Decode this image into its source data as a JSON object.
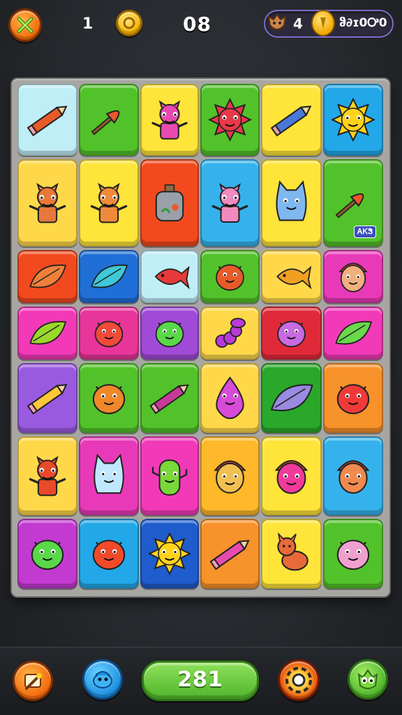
{
  "colors": {
    "board": "#a7a6a3",
    "accent_green": "#4fb52b",
    "accent_orange": "#f26a0c"
  },
  "topbar": {
    "close_icon": "crossed-swords-icon",
    "lives": "1",
    "coin_icon": "coin-icon",
    "level": "08",
    "mascot_icon": "fox-mascot-icon",
    "gems": "4",
    "gold_icon": "gold-coin-icon",
    "gold": "ჵ∂ɪ0Ꭴ0"
  },
  "board": {
    "rows": [
      [
        {
          "bg": "#bfeef7",
          "icon": "pencil-icon",
          "art": "pencil",
          "c": "#e85a2a"
        },
        {
          "bg": "#52c22a",
          "icon": "brush-icon",
          "art": "brush",
          "c": "#e8582a"
        },
        {
          "bg": "#ffe43a",
          "icon": "girl-doll-icon",
          "art": "figure",
          "c": "#e84ab0"
        },
        {
          "bg": "#52c22a",
          "icon": "red-sun-icon",
          "art": "sun",
          "c": "#e8394a"
        },
        {
          "bg": "#ffe43a",
          "icon": "pencil-icon",
          "art": "pencil",
          "c": "#4a78d8"
        },
        {
          "bg": "#22a8e8",
          "icon": "sun-icon",
          "art": "sun",
          "c": "#ffd31a"
        }
      ],
      [
        {
          "bg": "#ffd84a",
          "icon": "fox-figure-icon",
          "art": "figure",
          "c": "#e8783a"
        },
        {
          "bg": "#ffe43a",
          "icon": "bear-figure-icon",
          "art": "figure",
          "c": "#ef8a3a"
        },
        {
          "bg": "#f24a1e",
          "icon": "potion-bottle-icon",
          "art": "bottle",
          "c": "#9aa0a8"
        },
        {
          "bg": "#35b2ec",
          "icon": "girl-figure-icon",
          "art": "figure",
          "c": "#f08abf"
        },
        {
          "bg": "#ffe43a",
          "icon": "blue-cat-icon",
          "art": "cat",
          "c": "#7fb8f0"
        },
        {
          "bg": "#52c22a",
          "icon": "paintbrush-icon",
          "art": "brush",
          "c": "#e8582a",
          "badge": "ᎪᏦᏕ"
        }
      ],
      [
        {
          "bg": "#f24a1e",
          "icon": "leaf-icon",
          "art": "leaf",
          "c": "#f0803a"
        },
        {
          "bg": "#1f6fd6",
          "icon": "leaf-icon",
          "art": "leaf",
          "c": "#3ec8d8"
        },
        {
          "bg": "#bfeef7",
          "icon": "red-fish-icon",
          "art": "fish",
          "c": "#e8393a"
        },
        {
          "bg": "#52c22a",
          "icon": "fox-critter-icon",
          "art": "blob",
          "c": "#e85a2a"
        },
        {
          "bg": "#ffd84a",
          "icon": "goldfish-icon",
          "art": "fish",
          "c": "#f0a020"
        },
        {
          "bg": "#e83ab8",
          "icon": "girl-face-icon",
          "art": "face",
          "c": "#f0b080"
        }
      ],
      [
        {
          "bg": "#f23ab8",
          "icon": "leaf-icon",
          "art": "leaf",
          "c": "#9ad82a"
        },
        {
          "bg": "#e8359a",
          "icon": "red-critter-icon",
          "art": "blob",
          "c": "#f04a3a"
        },
        {
          "bg": "#a04ad8",
          "icon": "green-blob-icon",
          "art": "blob",
          "c": "#5ad84a"
        },
        {
          "bg": "#ffd84a",
          "icon": "purple-worm-icon",
          "art": "worm",
          "c": "#b83ad8"
        },
        {
          "bg": "#e02a3a",
          "icon": "purple-critter-icon",
          "art": "blob",
          "c": "#c86ae0"
        },
        {
          "bg": "#f23ab8",
          "icon": "leaf-icon",
          "art": "leaf",
          "c": "#6ad84a"
        }
      ],
      [
        {
          "bg": "#9a5ae0",
          "icon": "pencil-icon",
          "art": "pencil",
          "c": "#ffc83a"
        },
        {
          "bg": "#52c22a",
          "icon": "orange-blob-icon",
          "art": "blob",
          "c": "#f0882a"
        },
        {
          "bg": "#52c22a",
          "icon": "pencil-icon",
          "art": "pencil",
          "c": "#c83a9a"
        },
        {
          "bg": "#ffd84a",
          "icon": "purple-drop-icon",
          "art": "drop",
          "c": "#d84ad8"
        },
        {
          "bg": "#2aa82a",
          "icon": "crystal-icon",
          "art": "leaf",
          "c": "#9a8ae0"
        },
        {
          "bg": "#f8922a",
          "icon": "red-blob-icon",
          "art": "blob",
          "c": "#f03a3a"
        }
      ],
      [
        {
          "bg": "#ffd84a",
          "icon": "boy-figure-icon",
          "art": "figure",
          "c": "#e84a2a"
        },
        {
          "bg": "#e83ab8",
          "icon": "white-cat-icon",
          "art": "cat",
          "c": "#bfe8ff"
        },
        {
          "bg": "#f23ab8",
          "icon": "cactus-icon",
          "art": "cactus",
          "c": "#7ad83a"
        },
        {
          "bg": "#ffb82a",
          "icon": "green-hat-face-icon",
          "art": "face",
          "c": "#f0c050"
        },
        {
          "bg": "#ffe43a",
          "icon": "pink-face-icon",
          "art": "face",
          "c": "#f03a9a"
        },
        {
          "bg": "#35b2ec",
          "icon": "boy-face-icon",
          "art": "face",
          "c": "#f08a50"
        }
      ],
      [
        {
          "bg": "#c23ad0",
          "icon": "green-blob-icon",
          "art": "blob",
          "c": "#5ad84a"
        },
        {
          "bg": "#22a8e8",
          "icon": "red-critter-icon",
          "art": "blob",
          "c": "#f04a2a"
        },
        {
          "bg": "#1f5ccc",
          "icon": "sun-icon",
          "art": "sun",
          "c": "#ffd31a"
        },
        {
          "bg": "#f8922a",
          "icon": "pencil-icon",
          "art": "pencil",
          "c": "#e84ab0"
        },
        {
          "bg": "#ffe43a",
          "icon": "dog-icon",
          "art": "dog",
          "c": "#e86a3a"
        },
        {
          "bg": "#52c22a",
          "icon": "pink-critter-icon",
          "art": "blob",
          "c": "#f0a0d0"
        }
      ]
    ]
  },
  "bottombar": {
    "hint_icon": "magic-wand-icon",
    "shuffle_icon": "blue-bird-icon",
    "score": "281",
    "target_icon": "target-ring-icon",
    "creature_icon": "green-monster-icon"
  }
}
